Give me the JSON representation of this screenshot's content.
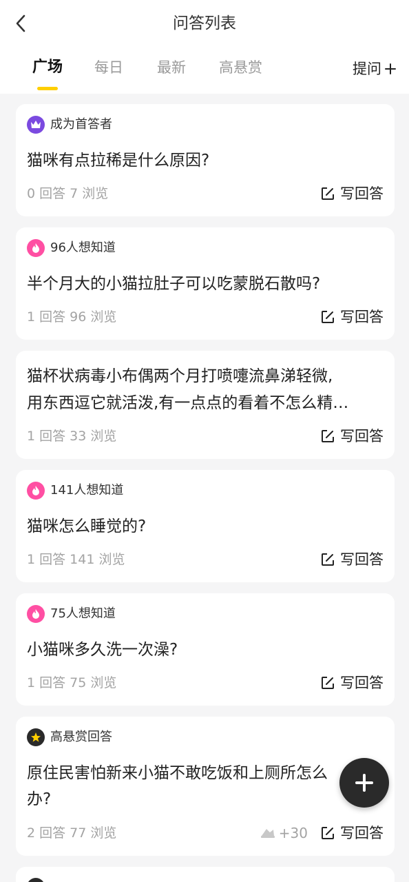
{
  "header": {
    "title": "问答列表"
  },
  "tabs": [
    {
      "label": "广场"
    },
    {
      "label": "每日"
    },
    {
      "label": "最新"
    },
    {
      "label": "高悬赏"
    }
  ],
  "ask_label": "提问",
  "write_label": "写回答",
  "cards": [
    {
      "badge": "成为首答者",
      "badge_icon": "crown-icon",
      "question": "猫咪有点拉稀是什么原因?",
      "stats": "0 回答  7 浏览"
    },
    {
      "badge": "96人想知道",
      "badge_icon": "fire-icon",
      "question": "半个月大的小猫拉肚子可以吃蒙脱石散吗?",
      "stats": "1 回答  96 浏览"
    },
    {
      "question_line1": "猫杯状病毒小布偶两个月打喷嚏流鼻涕轻微,",
      "question_line2": "用东西逗它就活泼,有一点点的看着不怎么精…",
      "stats": "1 回答  33 浏览"
    },
    {
      "badge": "141人想知道",
      "badge_icon": "fire-icon",
      "question": "猫咪怎么睡觉的?",
      "stats": "1 回答  141 浏览"
    },
    {
      "badge": "75人想知道",
      "badge_icon": "fire-icon",
      "question": "小猫咪多久洗一次澡?",
      "stats": "1 回答  75 浏览"
    },
    {
      "badge": "高悬赏回答",
      "badge_icon": "star-icon",
      "question_line1": "原住民害怕新来小猫不敢吃饭和上厕所怎么",
      "question_line2": "办?",
      "stats": "2 回答  77 浏览",
      "reward": "+30"
    }
  ],
  "colors": {
    "accent": "#ffcf00",
    "fire": "#ff4fa3",
    "crown": "#7b4ae0",
    "fab": "#2a2a2a"
  }
}
